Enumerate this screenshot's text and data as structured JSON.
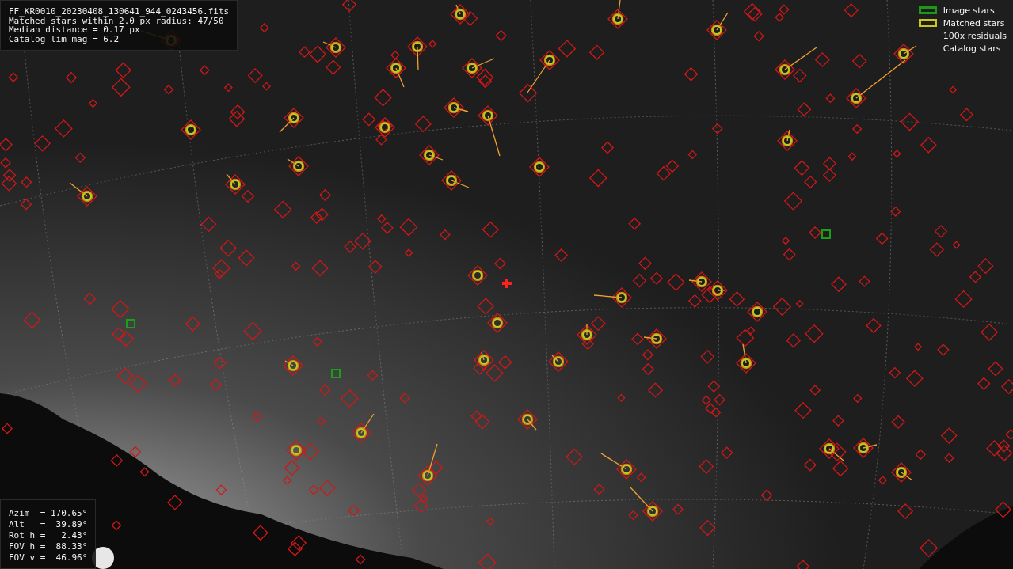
{
  "info_box": {
    "lines": [
      "FF_KR0010_20230408_130641_944_0243456.fits",
      "Matched stars within 2.0 px radius: 47/50",
      "Median distance = 0.17 px",
      "Catalog lim mag = 6.2"
    ]
  },
  "legend": {
    "items": [
      {
        "kind": "image",
        "label": "Image stars"
      },
      {
        "kind": "matched",
        "label": "Matched stars"
      },
      {
        "kind": "residual",
        "label": "100x residuals"
      },
      {
        "kind": "catalog",
        "label": "Catalog stars"
      }
    ]
  },
  "pointing_box": {
    "lines": [
      "Azim  = 170.65°",
      "Alt   =  39.89°",
      "Rot h =   2.43°",
      "FOV h =  88.33°",
      "FOV v =  46.96°"
    ]
  }
}
